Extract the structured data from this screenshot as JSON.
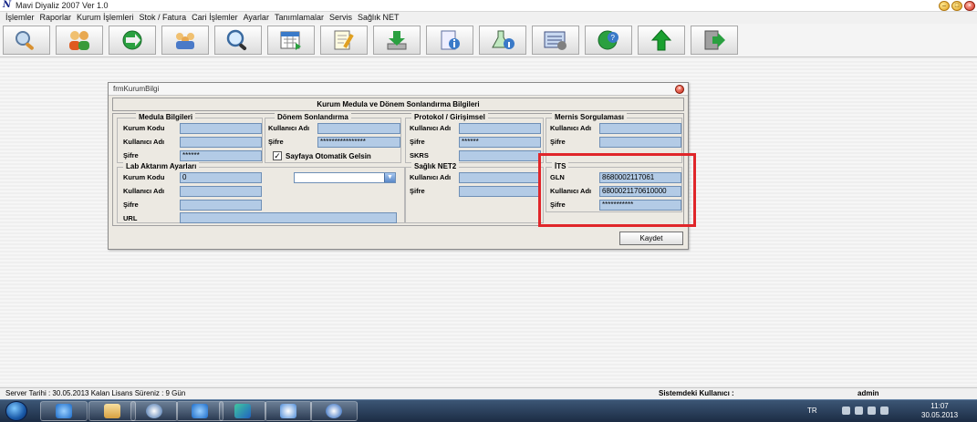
{
  "app": {
    "title": "Mavi Diyaliz 2007 Ver 1.0",
    "icon_letter": "N"
  },
  "window_controls": [
    "minimize",
    "maximize",
    "close"
  ],
  "menu": [
    "İşlemler",
    "Raporlar",
    "Kurum İşlemleri",
    "Stok / Fatura",
    "Cari İşlemler",
    "Ayarlar",
    "Tanımlamalar",
    "Servis",
    "Sağlık NET"
  ],
  "toolbar_icons": [
    "search-people-icon",
    "patients-icon",
    "globe-arrow-icon",
    "users-group-icon",
    "magnifier-icon",
    "calendar-sheet-icon",
    "notepad-pen-icon",
    "download-icon",
    "document-info-icon",
    "flask-info-icon",
    "config-panel-icon",
    "help-globe-icon",
    "up-arrow-icon",
    "exit-door-icon"
  ],
  "form": {
    "window_title": "frmKurumBilgi",
    "header": "Kurum Medula ve Dönem Sonlandırma Bilgileri",
    "medula": {
      "legend": "Medula Bilgileri",
      "kurum_kodu_label": "Kurum Kodu",
      "kurum_kodu_value": "",
      "kullanici_label": "Kullanıcı Adı",
      "kullanici_value": "",
      "sifre_label": "Şifre",
      "sifre_value": "******"
    },
    "donem": {
      "legend": "Dönem Sonlandırma",
      "kullanici_label": "Kullanıcı Adı",
      "kullanici_value": "",
      "sifre_label": "Şifre",
      "sifre_value": "****************",
      "checkbox_label": "Sayfaya Otomatik Gelsin",
      "checkbox_mark": "✓"
    },
    "protokol": {
      "legend": "Protokol / Girişimsel",
      "kullanici_label": "Kullanıcı Adı",
      "kullanici_value": "",
      "sifre_label": "Şifre",
      "sifre_value": "******",
      "skrs_label": "SKRS",
      "skrs_value": ""
    },
    "mernis": {
      "legend": "Mernis Sorgulaması",
      "kullanici_label": "Kullanıcı Adı",
      "kullanici_value": "",
      "sifre_label": "Şifre",
      "sifre_value": ""
    },
    "lab": {
      "legend": "Lab Aktarım Ayarları",
      "kurum_kodu_label": "Kurum Kodu",
      "kurum_kodu_value": "0",
      "kullanici_label": "Kullanıcı Adı",
      "kullanici_value": "",
      "sifre_label": "Şifre",
      "sifre_value": "",
      "url_label": "URL",
      "url_value": "",
      "combo_value": ""
    },
    "saglik_net2": {
      "legend": "Sağlık NET2",
      "kullanici_label": "Kullanıcı Adı",
      "kullanici_value": "",
      "sifre_label": "Şifre",
      "sifre_value": ""
    },
    "its": {
      "legend": "İTS",
      "gln_label": "GLN",
      "gln_value": "8680002117061",
      "kullanici_label": "Kullanıcı Adı",
      "kullanici_value": "6800021170610000",
      "sifre_label": "Şifre",
      "sifre_value": "***********"
    },
    "save_label": "Kaydet"
  },
  "status": {
    "left": "Server Tarihi : 30.05.2013  Kalan Lisans Süreniz : 9 Gün",
    "user_label": "Sistemdeki Kullanıcı :",
    "user_value": "admin"
  },
  "taskbar": {
    "lang": "TR",
    "time": "11:07",
    "date": "30.05.2013",
    "items": [
      "ie-icon",
      "explorer-icon",
      "media-icon",
      "ie-icon",
      "app-grid-icon",
      "medical-icon",
      "teamviewer-icon"
    ]
  },
  "colors": {
    "field_bg": "#b3cbe6",
    "highlight": "#e0262a"
  }
}
